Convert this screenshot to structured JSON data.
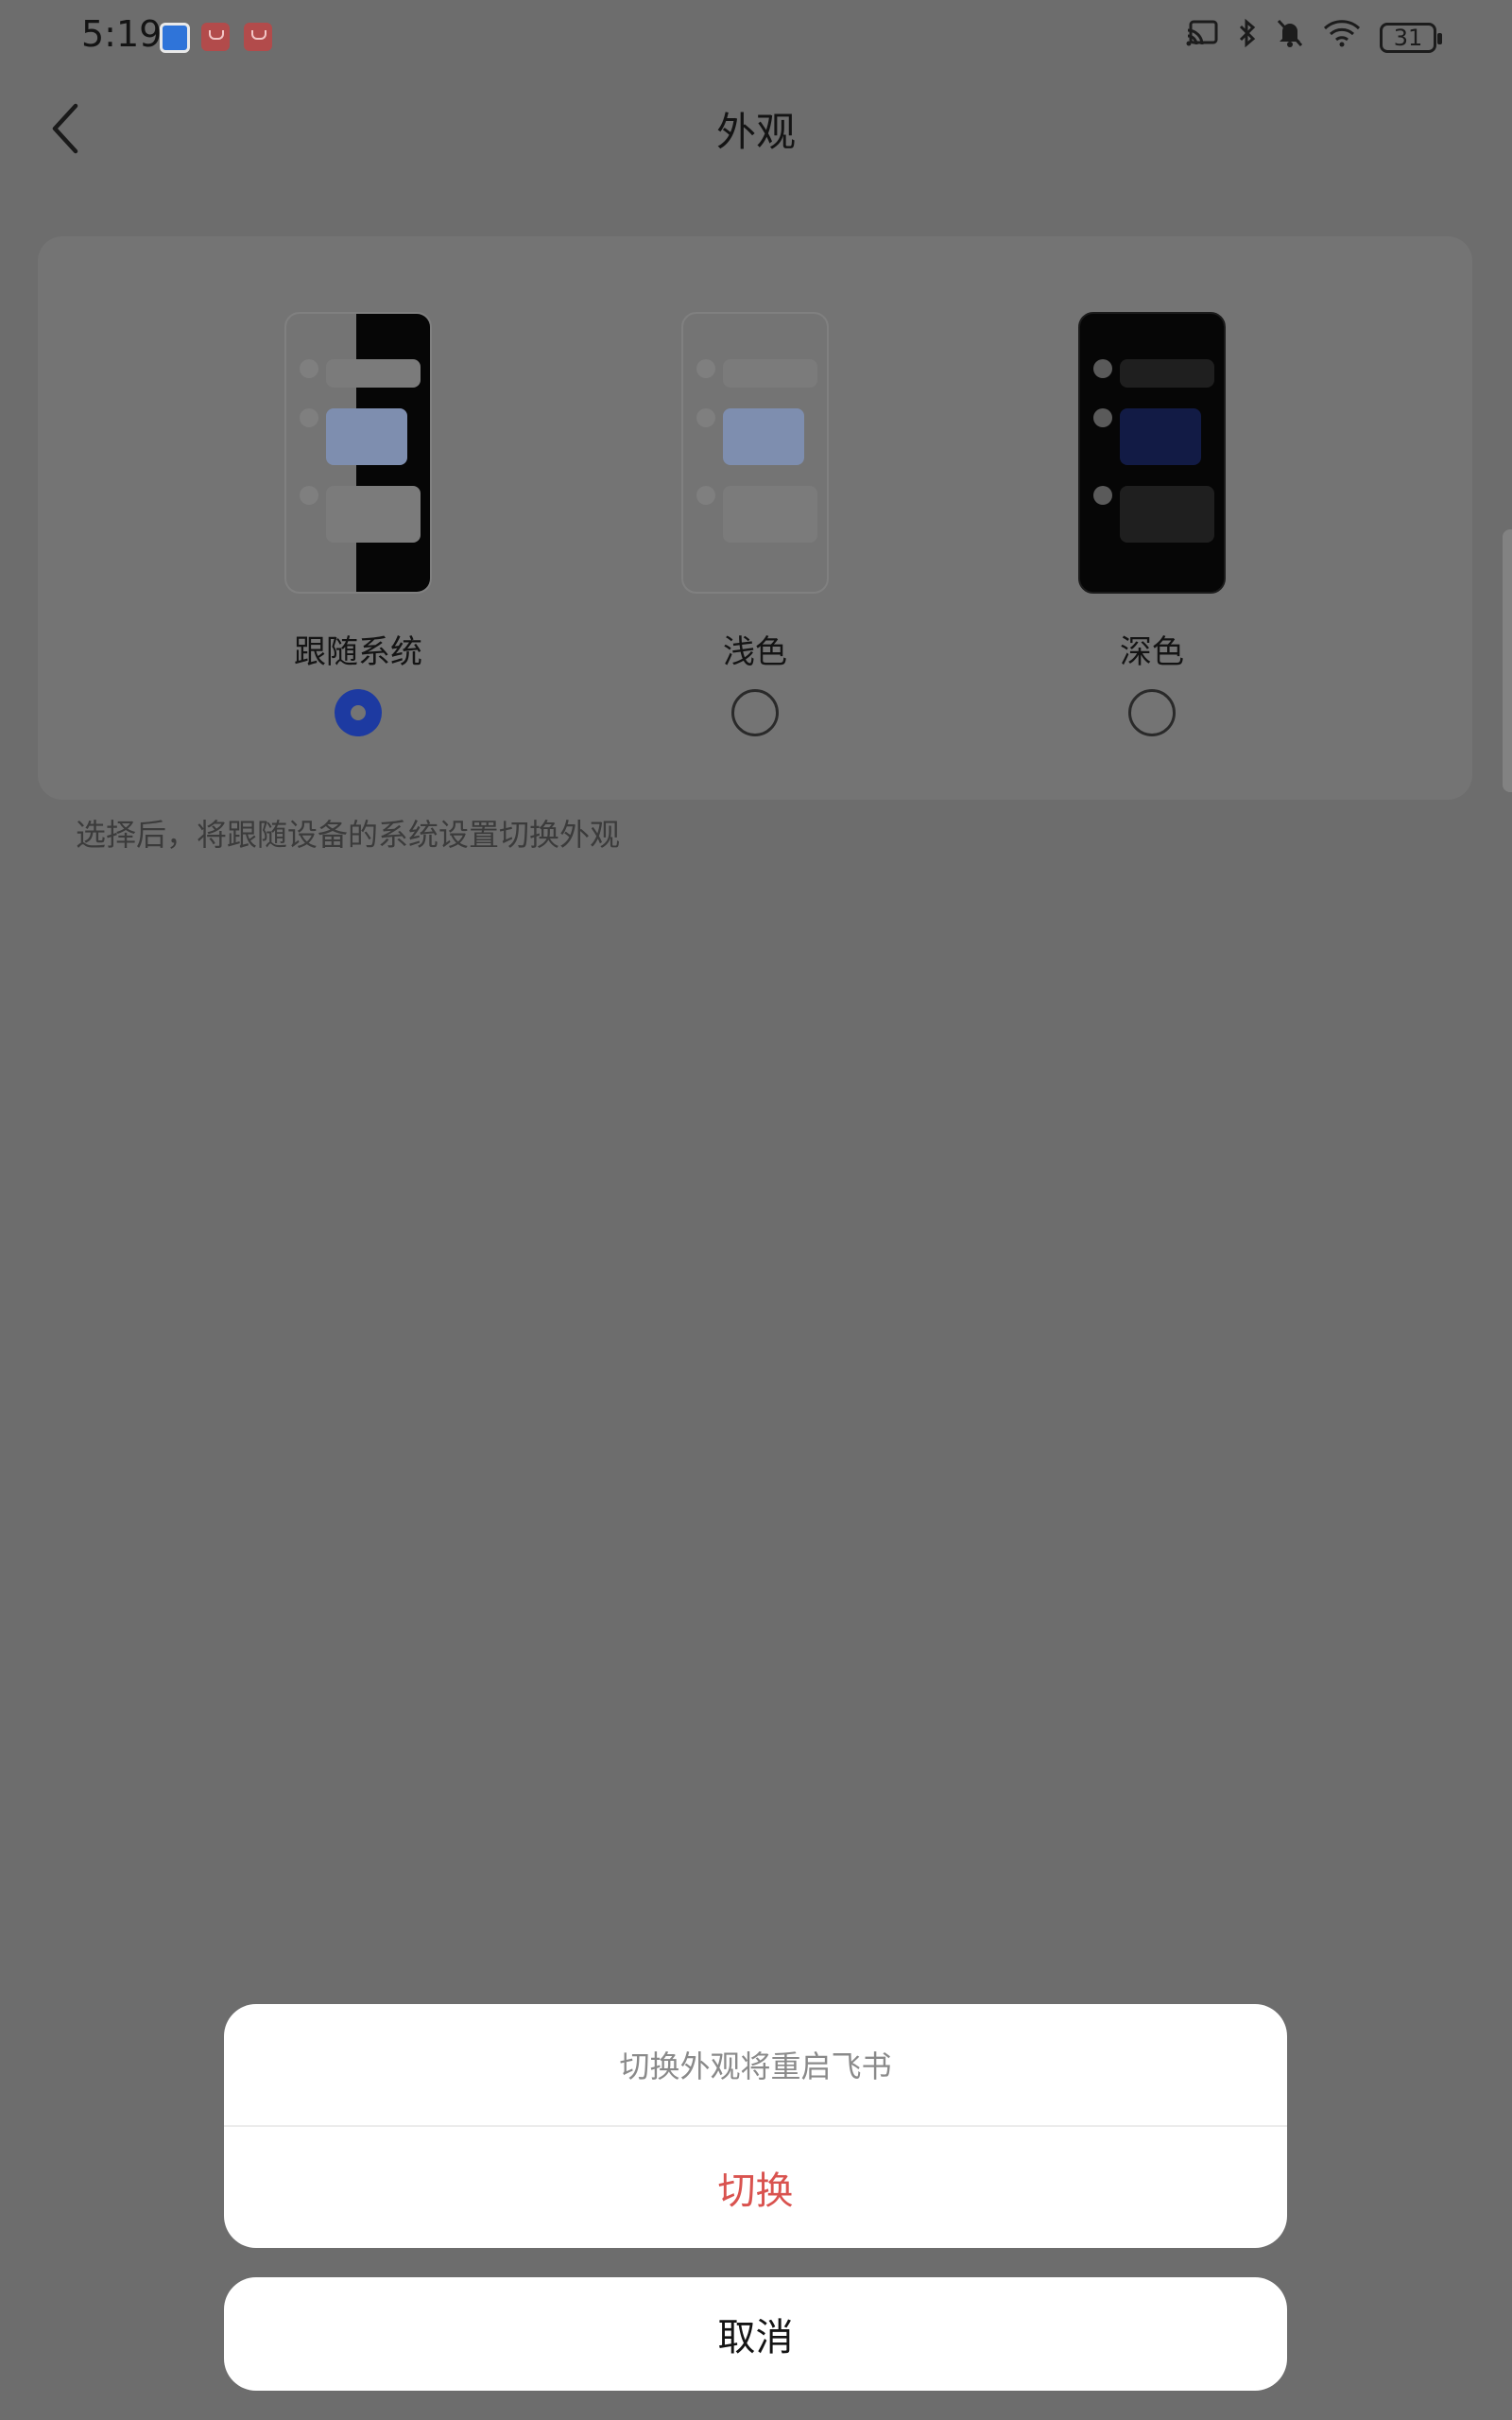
{
  "status_bar": {
    "time": "5:19",
    "battery": "31",
    "icons": [
      "security-app-icon",
      "huawei-store-icon",
      "huawei-store-icon",
      "cast-icon",
      "bluetooth-icon",
      "bell-muted-icon",
      "wifi-icon",
      "battery-icon"
    ]
  },
  "header": {
    "title": "外观",
    "back_icon": "chevron-left-icon"
  },
  "appearance": {
    "options": [
      {
        "label": "跟随系统",
        "selected": true,
        "preview": "split"
      },
      {
        "label": "浅色",
        "selected": false,
        "preview": "light"
      },
      {
        "label": "深色",
        "selected": false,
        "preview": "dark"
      }
    ],
    "hint": "选择后，将跟随设备的系统设置切换外观"
  },
  "dialog": {
    "message": "切换外观将重启飞书",
    "confirm_label": "切换",
    "cancel_label": "取消"
  },
  "colors": {
    "accent": "#1d3aa1",
    "danger": "#d9534f",
    "overlay_background": "#6d6d6d"
  }
}
